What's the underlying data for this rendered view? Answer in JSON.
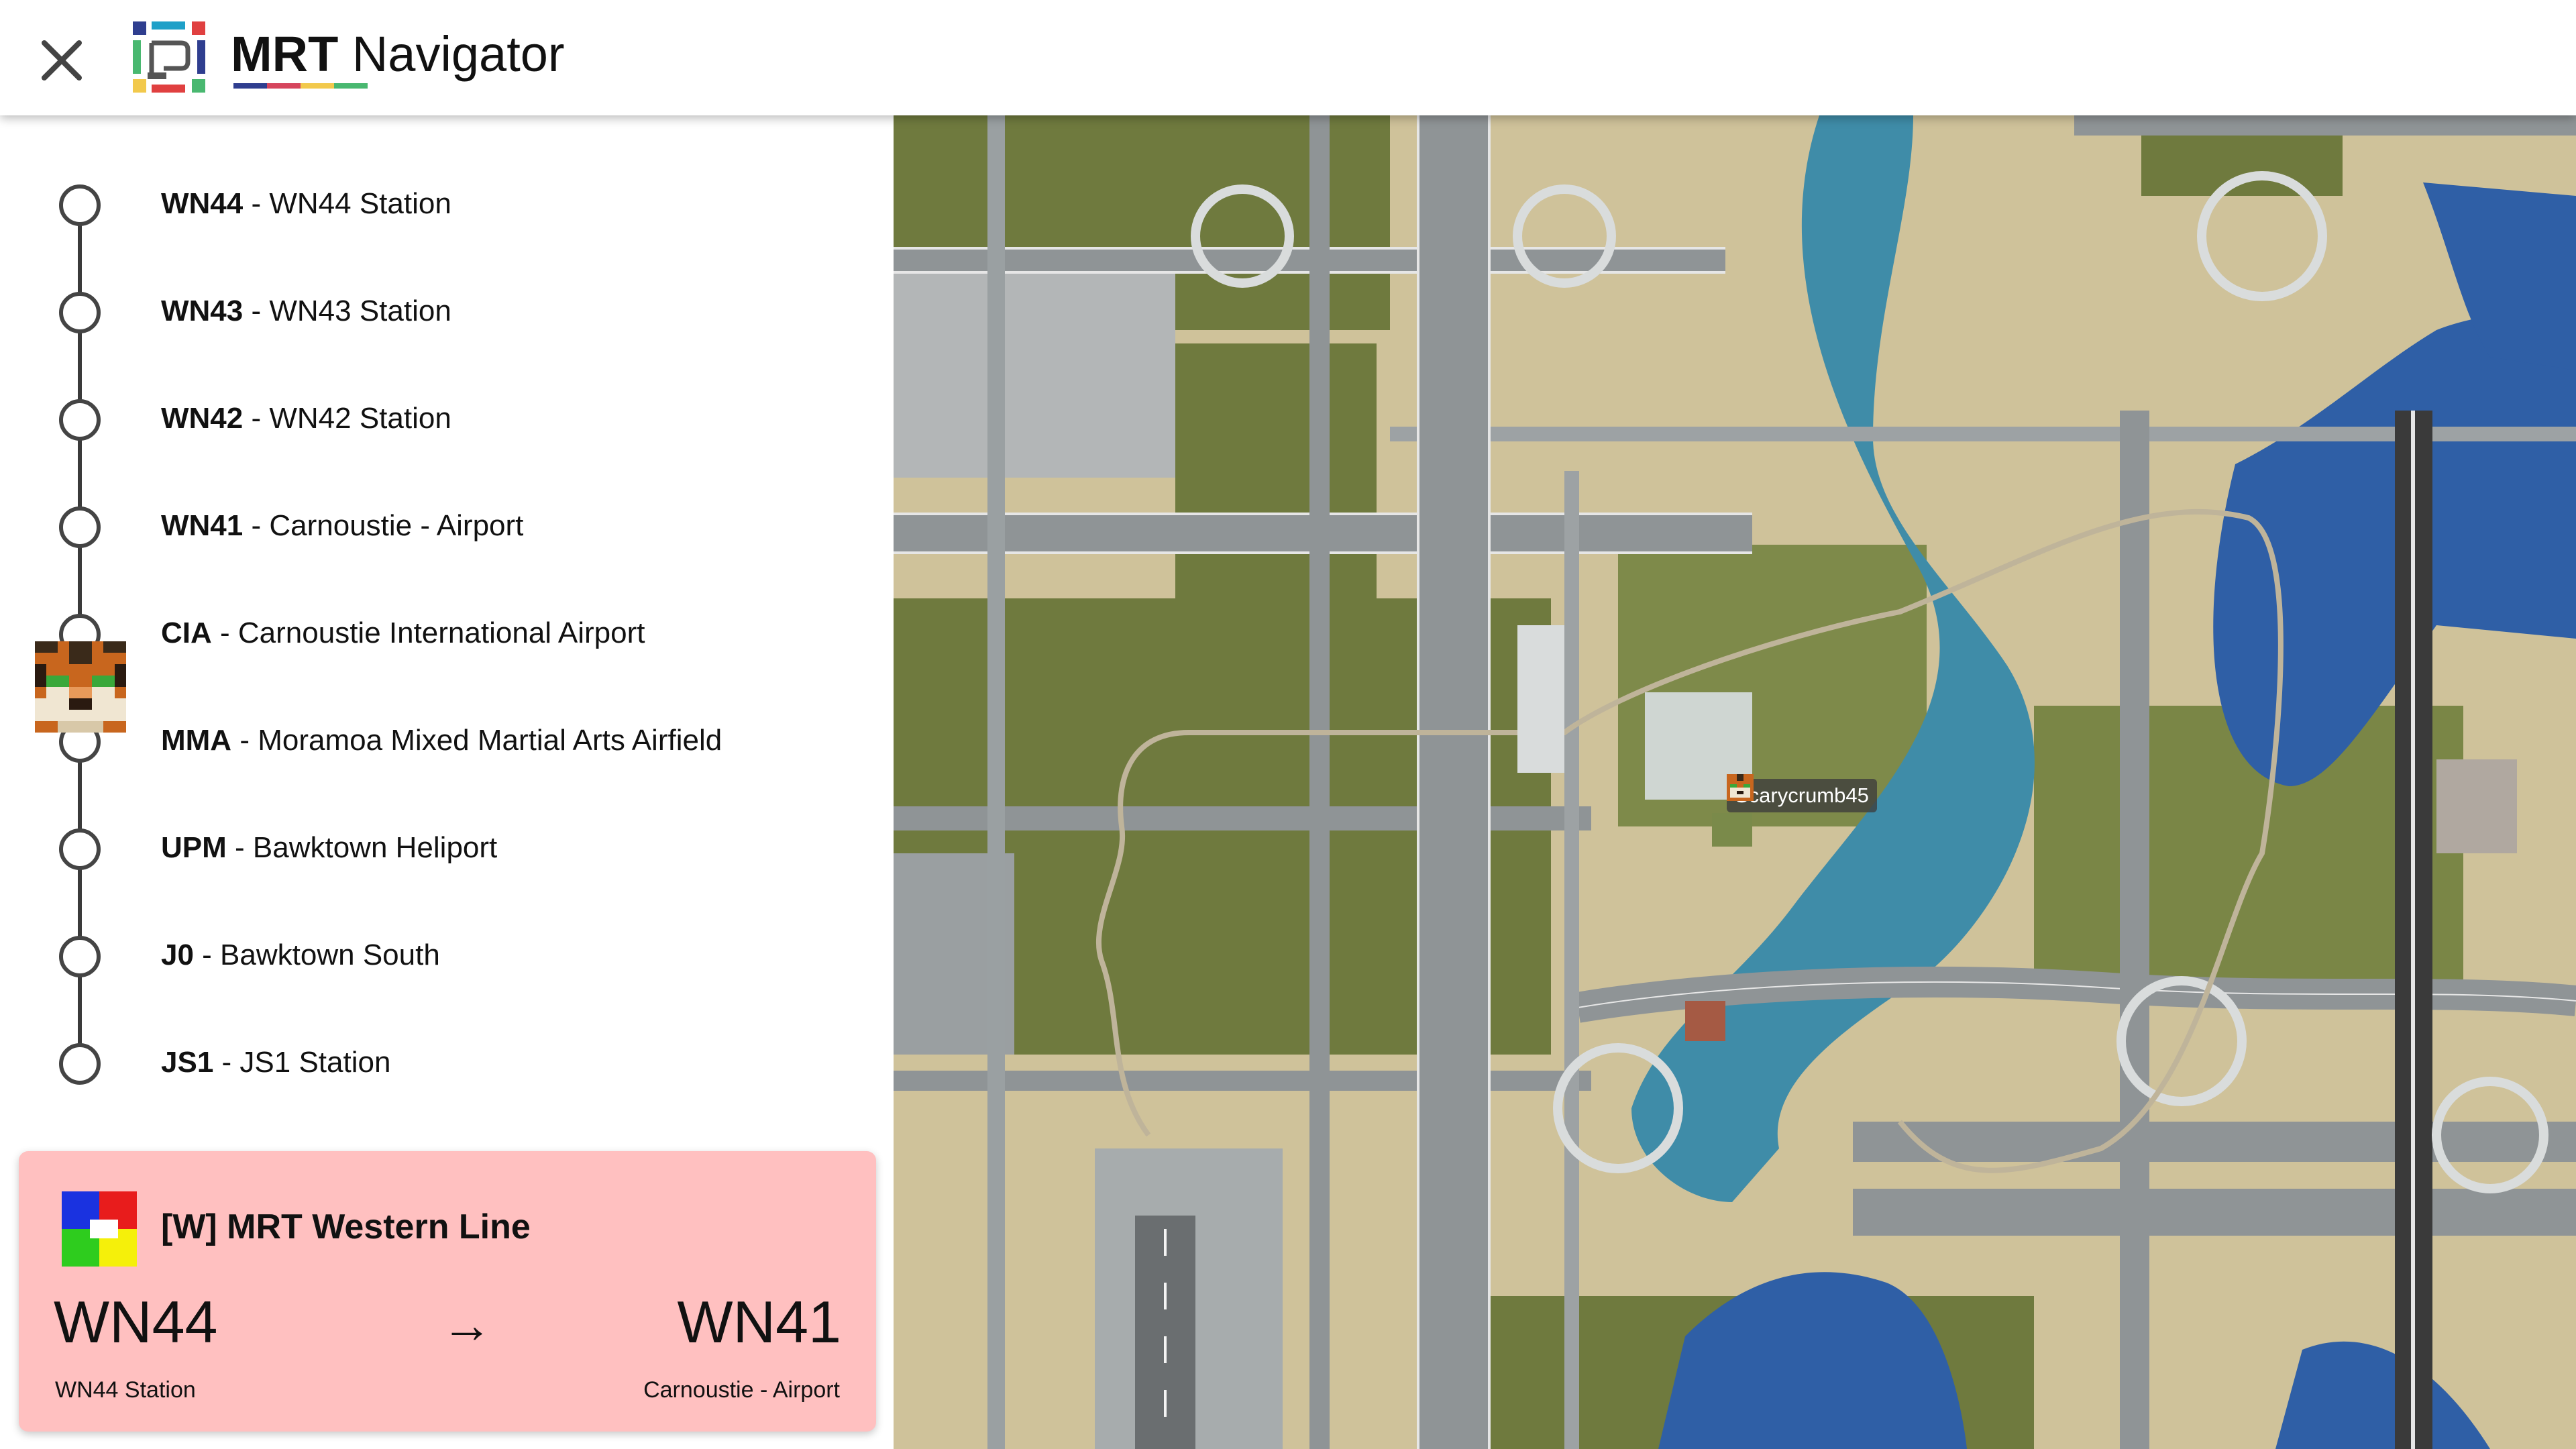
{
  "header": {
    "title_bold": "MRT",
    "title_rest": " Navigator",
    "accent_colors": [
      "#2f3e8f",
      "#d6455d",
      "#f2c94c",
      "#49b870"
    ]
  },
  "route": {
    "stops": [
      {
        "code": "WN44",
        "name": " - WN44 Station"
      },
      {
        "code": "WN43",
        "name": " - WN43 Station"
      },
      {
        "code": "WN42",
        "name": " - WN42 Station"
      },
      {
        "code": "WN41",
        "name": " - Carnoustie - Airport"
      },
      {
        "code": "CIA",
        "name": " - Carnoustie International Airport"
      },
      {
        "code": "MMA",
        "name": " - Moramoa Mixed Martial Arts Airfield"
      },
      {
        "code": "UPM",
        "name": " - Bawktown Heliport"
      },
      {
        "code": "J0",
        "name": " - Bawktown South"
      },
      {
        "code": "JS1",
        "name": " - JS1 Station"
      }
    ],
    "current_stop_code": "CIA"
  },
  "card": {
    "line_name": "[W] MRT Western Line",
    "from_code": "WN44",
    "from_name": "WN44 Station",
    "to_code": "WN41",
    "to_name": "Carnoustie - Airport",
    "arrow": "→",
    "background": "#ffc0c0",
    "line_icon_colors": [
      "#1a32e0",
      "#e81c1c",
      "#2ecc1e",
      "#f5f00a",
      "#ffffff"
    ]
  },
  "map": {
    "player_label": "Scarycrumb45",
    "colors": {
      "sand": "#cfc29a",
      "water": "#3f8ca8",
      "deep_water": "#2f5fa6",
      "grass": "#6f7a3e",
      "road": "#8f9496",
      "road_edge": "#e6e6e6"
    }
  },
  "icons": {
    "close": "close-icon",
    "logo": "mrt-logo-icon",
    "line": "line-color-icon",
    "avatar": "player-head-icon"
  }
}
